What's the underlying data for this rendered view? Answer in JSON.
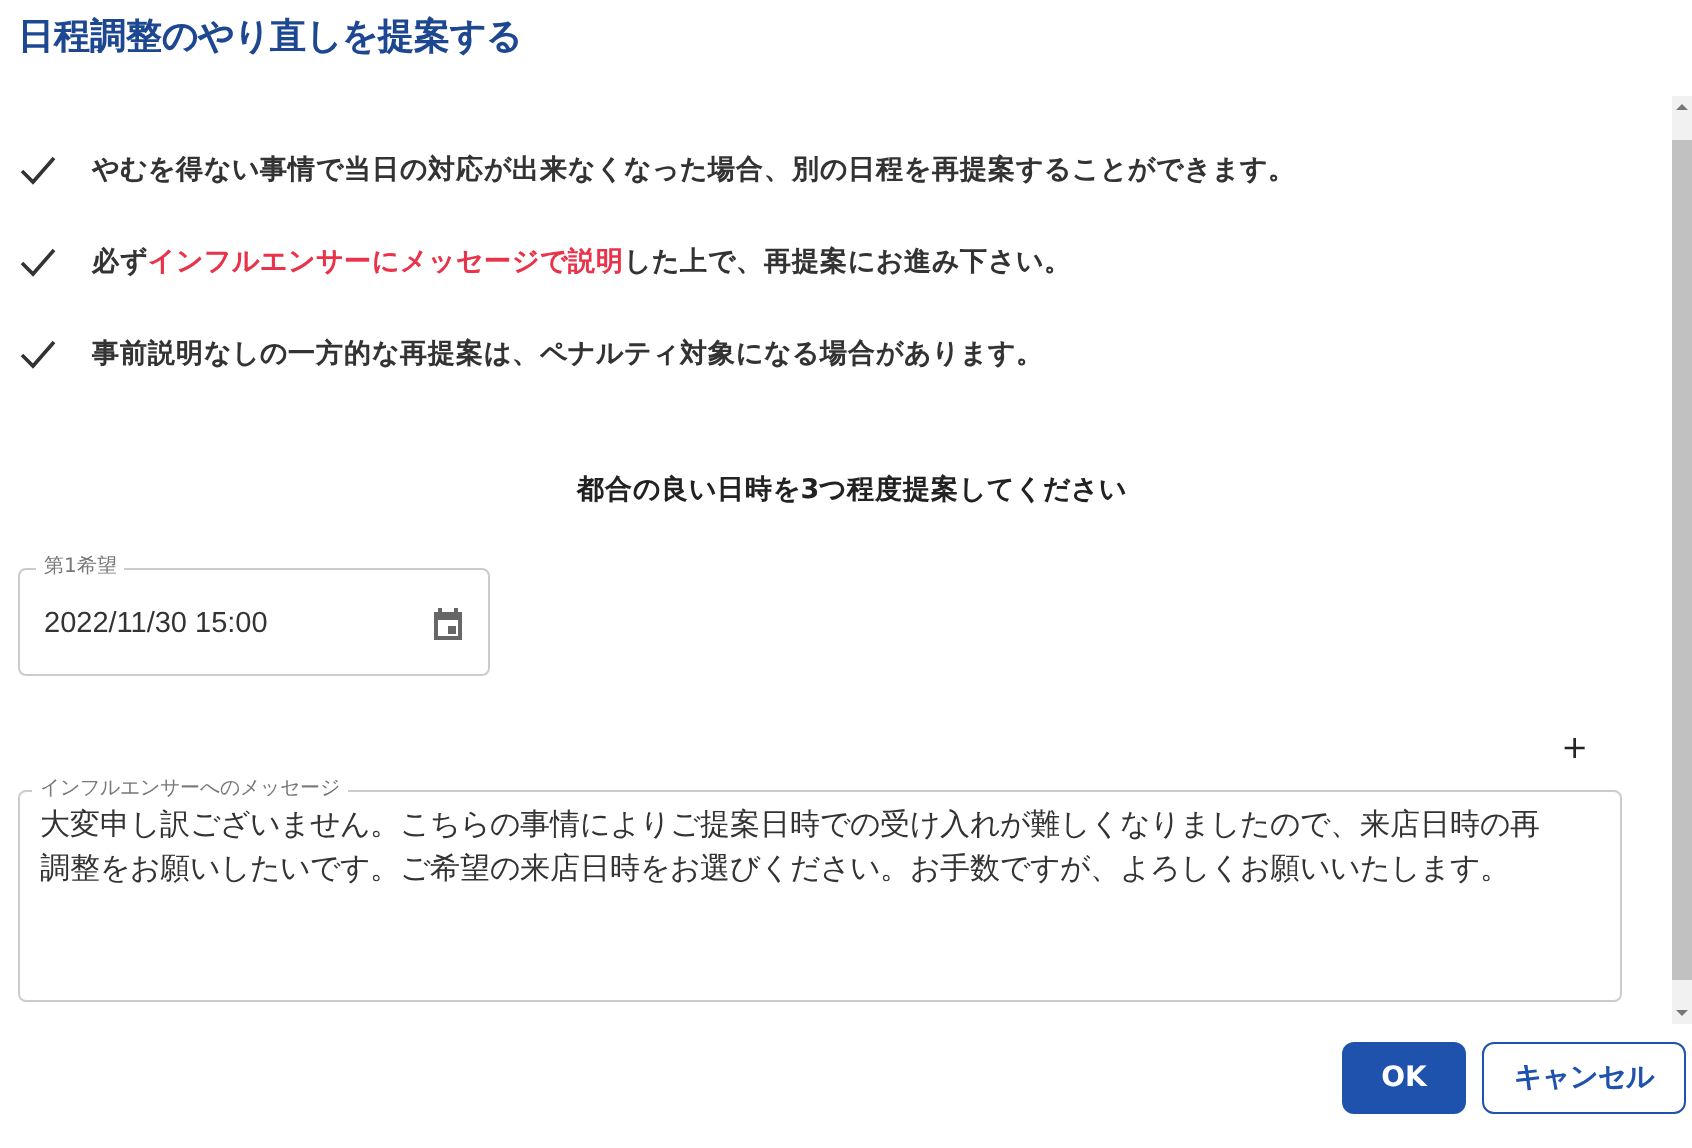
{
  "dialog": {
    "title": "日程調整のやり直しを提案する"
  },
  "notices": [
    {
      "parts": [
        {
          "text": "やむを得ない事情で当日の対応が出来なくなった場合、別の日程を再提案することができます。",
          "emphasis": false
        }
      ]
    },
    {
      "parts": [
        {
          "text": "必ず",
          "emphasis": false
        },
        {
          "text": "インフルエンサーにメッセージで説明",
          "emphasis": true
        },
        {
          "text": "した上で、再提案にお進み下さい。",
          "emphasis": false
        }
      ]
    },
    {
      "parts": [
        {
          "text": "事前説明なしの一方的な再提案は、ペナルティ対象になる場合があります。",
          "emphasis": false
        }
      ]
    }
  ],
  "instruction": "都合の良い日時を3つ程度提案してください",
  "date_fields": [
    {
      "label": "第1希望",
      "value": "2022/11/30 15:00"
    }
  ],
  "add_button": "+",
  "message": {
    "label": "インフルエンサーへのメッセージ",
    "value": "大変申し訳ございません。こちらの事情によりご提案日時での受け入れが難しくなりましたので、来店日時の再調整をお願いしたいです。ご希望の来店日時をお選びください。お手数ですが、よろしくお願いいたします。"
  },
  "buttons": [
    {
      "label": "OK",
      "kind": "primary"
    },
    {
      "label": "キャンセル",
      "kind": "secondary"
    }
  ]
}
